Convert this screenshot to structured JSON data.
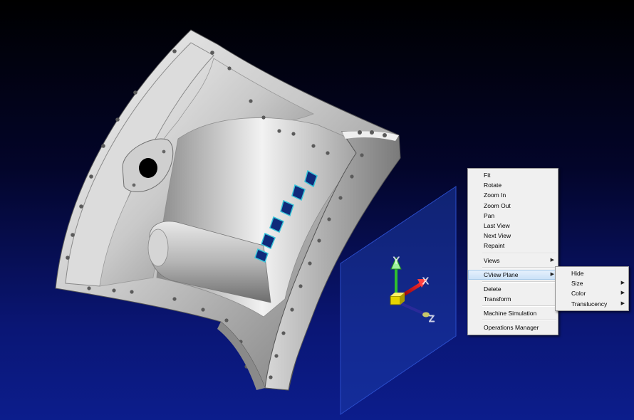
{
  "context_menu": {
    "items": [
      {
        "label": "Fit"
      },
      {
        "label": "Rotate"
      },
      {
        "label": "Zoom In"
      },
      {
        "label": "Zoom Out"
      },
      {
        "label": "Pan"
      },
      {
        "label": "Last View"
      },
      {
        "label": "Next View"
      },
      {
        "label": "Repaint"
      },
      {
        "label": "Views"
      },
      {
        "label": "CView Plane"
      },
      {
        "label": "Delete"
      },
      {
        "label": "Transform"
      },
      {
        "label": "Machine Simulation"
      },
      {
        "label": "Operations Manager"
      }
    ]
  },
  "submenu": {
    "items": [
      {
        "label": "Hide"
      },
      {
        "label": "Size"
      },
      {
        "label": "Color"
      },
      {
        "label": "Translucency"
      }
    ]
  },
  "axes": {
    "x": "X",
    "y": "Y",
    "z": "Z"
  },
  "colors": {
    "background_top": "#000000",
    "background_bottom": "#0c1d8c",
    "cview_plane": "#1c3aa8",
    "axis_x": "#d0202a",
    "axis_y": "#2fbf2f",
    "axis_z": "#2a2a9a",
    "origin_cube": "#e6d400",
    "menu_bg": "#f0f0f0",
    "menu_highlight": "#cde4f7"
  }
}
